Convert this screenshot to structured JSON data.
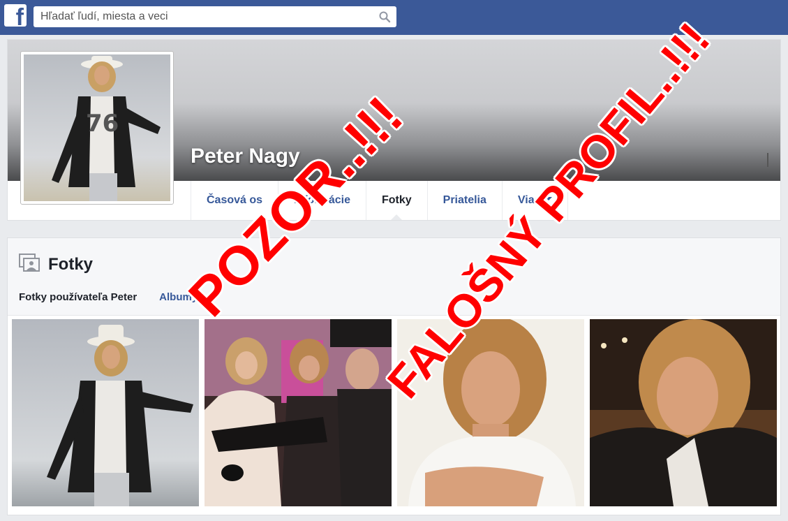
{
  "topbar": {
    "logo": "f",
    "search_placeholder": "Hľadať ľudí, miesta a veci"
  },
  "profile": {
    "name": "Peter Nagy",
    "shirt_number": "76"
  },
  "nav": {
    "items": [
      "Časová os",
      "Informácie",
      "Fotky",
      "Priatelia",
      "Viac"
    ],
    "active": "Fotky"
  },
  "photos": {
    "title": "Fotky",
    "tabs": [
      "Fotky používateľa Peter",
      "Albumy"
    ]
  },
  "overlay": {
    "line1": "POZOR..!!!",
    "line2": "FALOŠNÝ PROFIL..!!!"
  },
  "colors": {
    "brand": "#3b5998",
    "link": "#365899",
    "warning": "#ff0000"
  }
}
